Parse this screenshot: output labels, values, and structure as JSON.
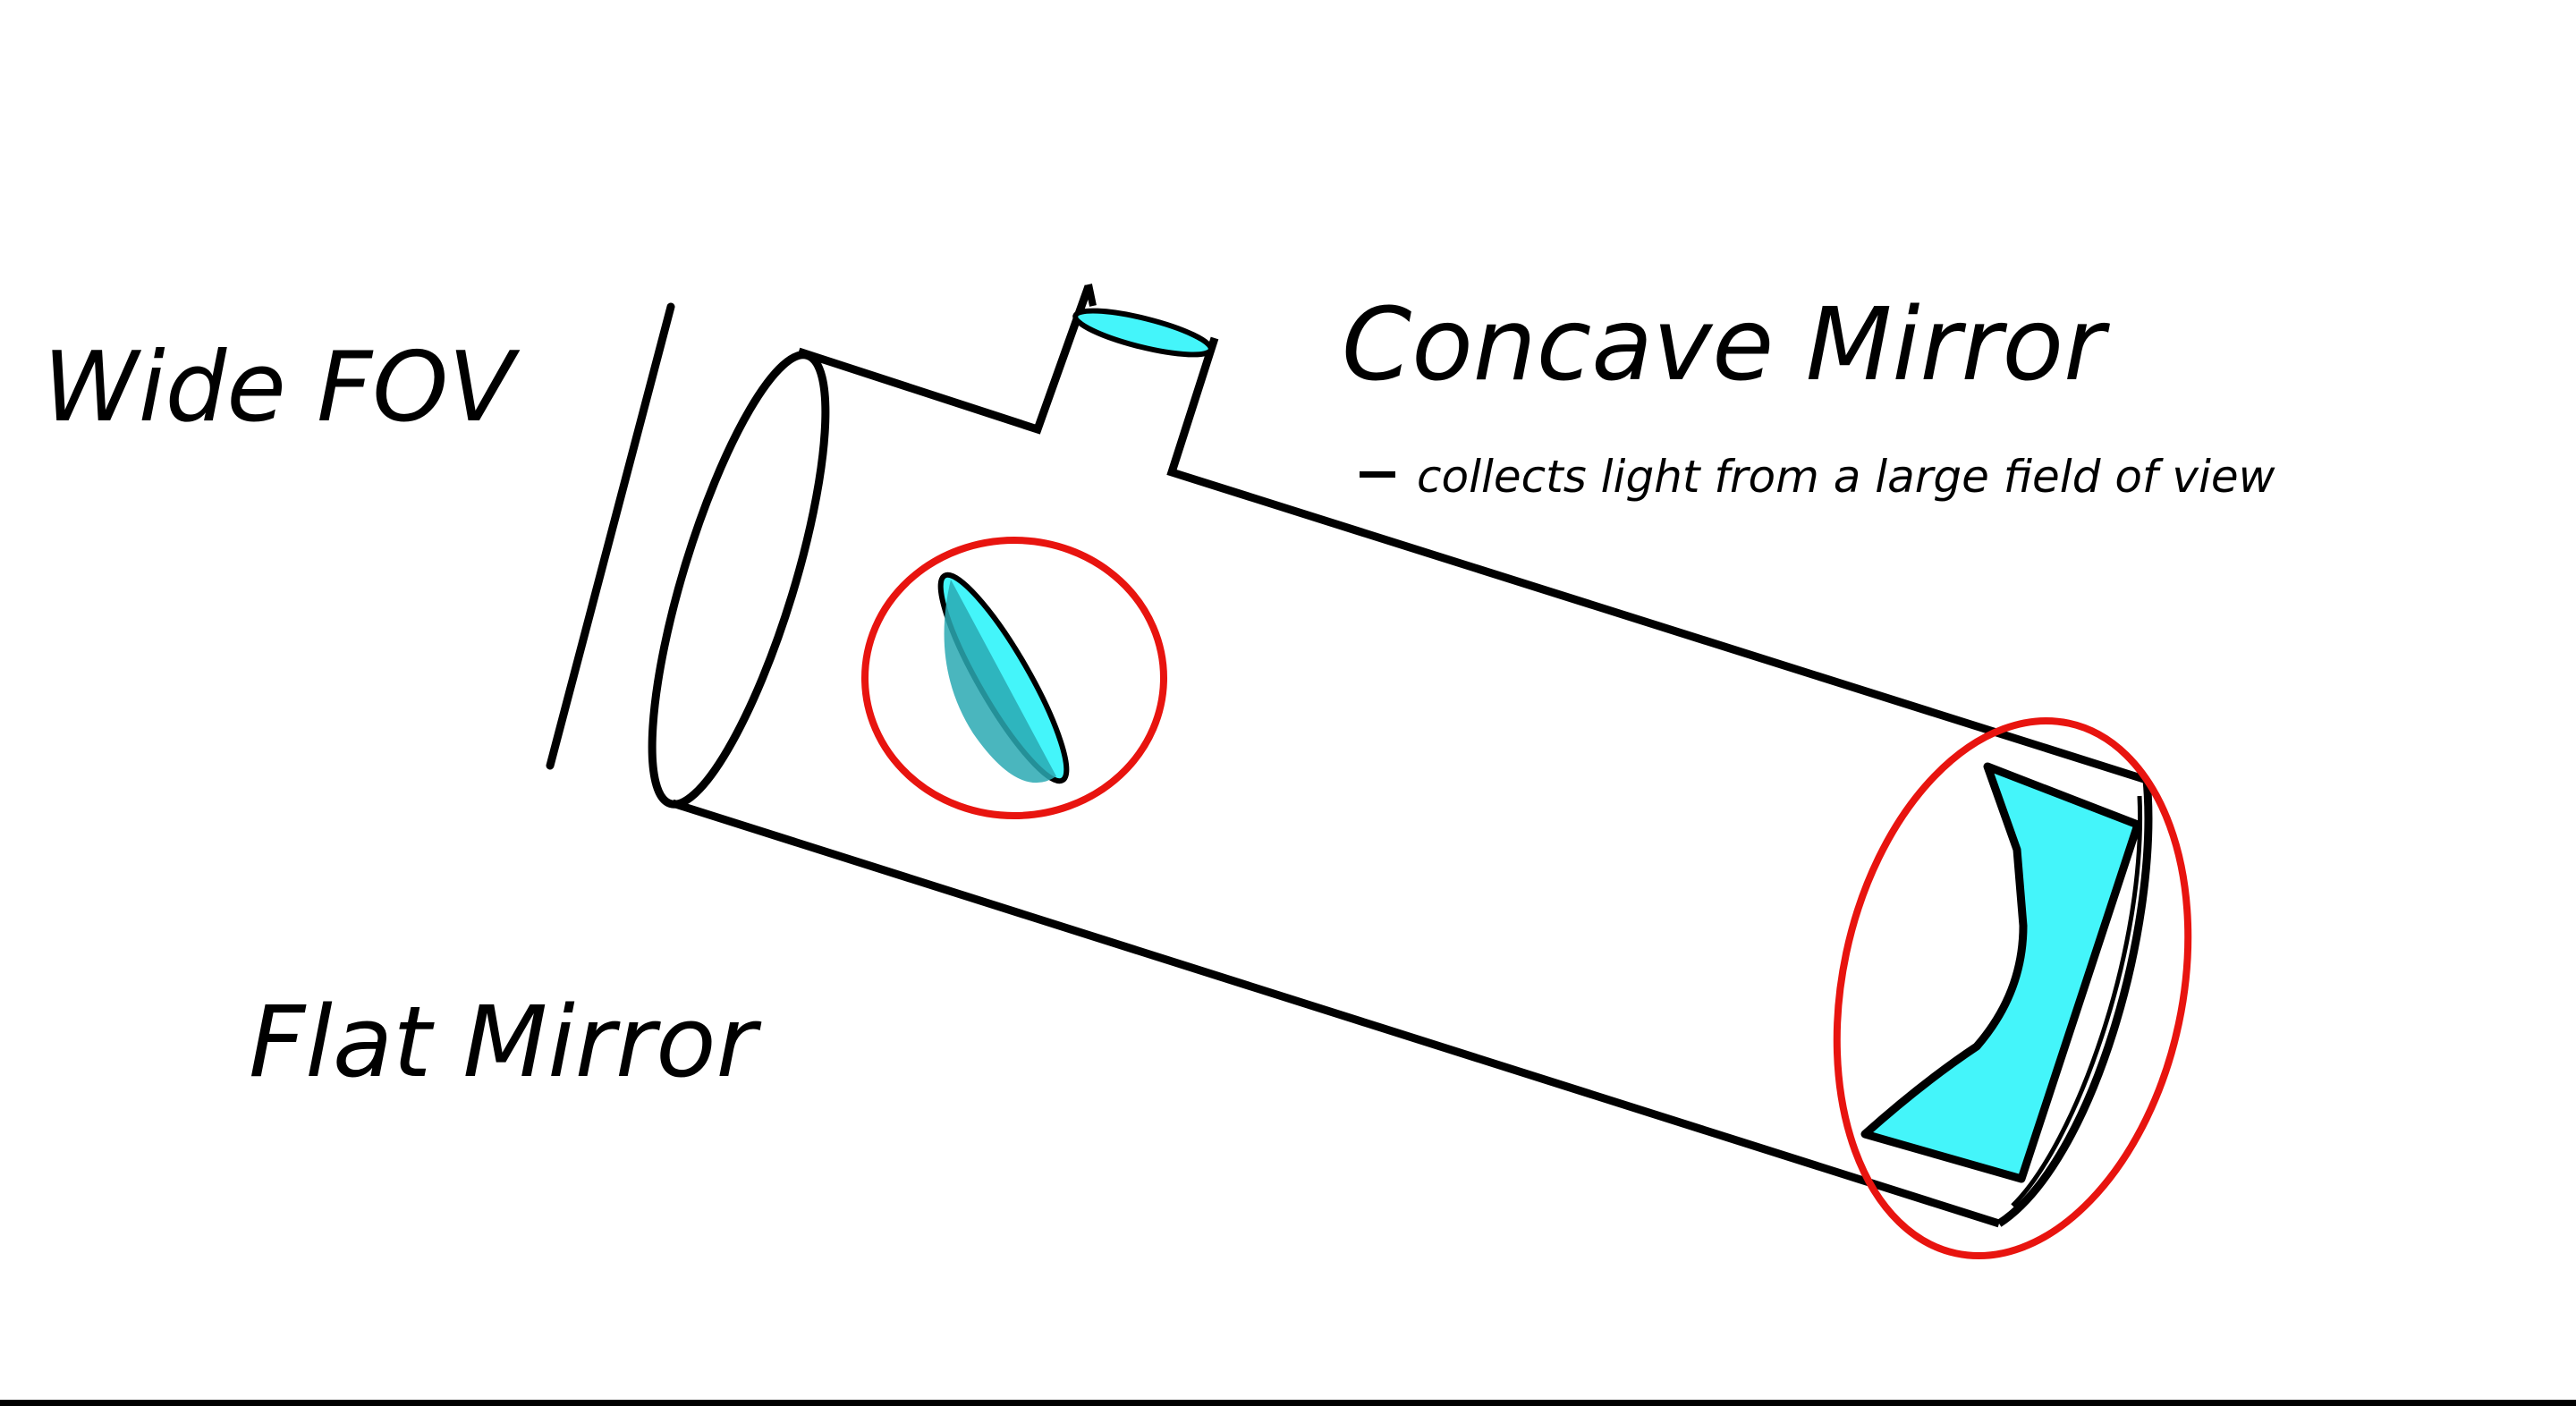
{
  "labels": {
    "wide_fov": "Wide FOV",
    "flat_mirror": "Flat Mirror",
    "concave_mirror": "Concave Mirror",
    "concave_note": "collects light from a large field of view"
  },
  "colors": {
    "outline": "#000000",
    "mirror_fill": "#44f5fa",
    "mirror_shade": "#2aa9b3",
    "highlight": "#e8140f",
    "background": "#ffffff"
  }
}
